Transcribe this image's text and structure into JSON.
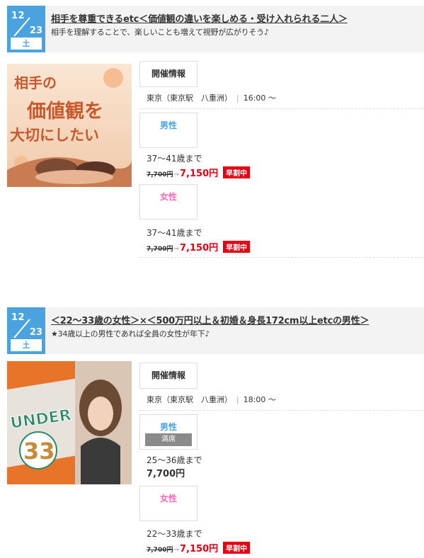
{
  "events": [
    {
      "date": {
        "month": "12",
        "day": "23",
        "weekday": "土"
      },
      "title": "相手を尊重できるetc＜価値観の違いを楽しめる・受け入れられる二人＞",
      "subtitle": "相手を理解することで、楽しいことも増えて視野が広がりそう♪",
      "image_text": [
        "相手の",
        "価値観を",
        "大切にしたい"
      ],
      "info_label": "開催情報",
      "location": "東京（東京駅　八重洲）",
      "time": "16:00 ～",
      "male": {
        "label": "男性",
        "age": "37〜41歳まで",
        "old_price": "7,700円",
        "price": "7,150円",
        "badge": "早割中"
      },
      "female": {
        "label": "女性",
        "age": "37〜41歳まで",
        "old_price": "7,700円",
        "price": "7,150円",
        "badge": "早割中"
      }
    },
    {
      "date": {
        "month": "12",
        "day": "23",
        "weekday": "土"
      },
      "title": "＜22〜33歳の女性＞×＜500万円以上＆初婚＆身長172cm以上etcの男性＞",
      "subtitle": "★34歳以上の男性であれば全員の女性が年下♪",
      "image_text": [
        "UNDER",
        "33"
      ],
      "info_label": "開催情報",
      "location": "東京（東京駅　八重洲）",
      "time": "18:00 ～",
      "male": {
        "label": "男性",
        "status": "満席",
        "age": "25〜36歳まで",
        "price": "7,700円"
      },
      "female": {
        "label": "女性",
        "age": "22〜33歳まで",
        "old_price": "7,700円",
        "price": "7,150円",
        "badge": "早割中"
      }
    }
  ]
}
